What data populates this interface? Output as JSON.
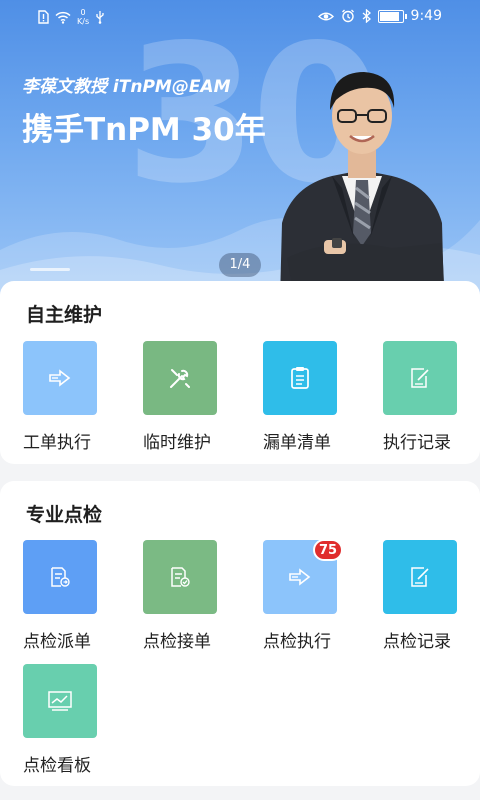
{
  "status_bar": {
    "net_speed_value": "0",
    "net_speed_unit": "K/s",
    "time": "9:49"
  },
  "banner": {
    "big_text": "30",
    "professor_line": "李葆文教授  iTnPM@EAM",
    "headline": "携手TnPM 30年",
    "pager": "1/4"
  },
  "section_autonomous": {
    "title": "自主维护",
    "items": [
      {
        "label": "工单执行",
        "icon": "arrow-right-icon",
        "color": "#8cc4fb"
      },
      {
        "label": "临时维护",
        "icon": "tools-icon",
        "color": "#79b882"
      },
      {
        "label": "漏单清单",
        "icon": "clipboard-icon",
        "color": "#2fbde9"
      },
      {
        "label": "执行记录",
        "icon": "edit-note-icon",
        "color": "#68cfae"
      }
    ]
  },
  "section_inspection": {
    "title": "专业点检",
    "items": [
      {
        "label": "点检派单",
        "icon": "dispatch-doc-icon",
        "color": "#5e9ff5"
      },
      {
        "label": "点检接单",
        "icon": "accept-doc-icon",
        "color": "#7bba84"
      },
      {
        "label": "点检执行",
        "icon": "arrow-right-icon",
        "color": "#8cc4fb",
        "badge": "75"
      },
      {
        "label": "点检记录",
        "icon": "edit-note-icon",
        "color": "#2fbde9"
      },
      {
        "label": "点检看板",
        "icon": "dashboard-chart-icon",
        "color": "#68cfae"
      }
    ]
  }
}
